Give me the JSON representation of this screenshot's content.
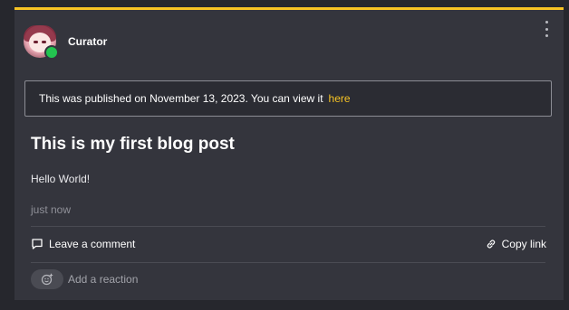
{
  "post": {
    "author": "Curator",
    "notice_text": "This was published on November 13, 2023. You can view it",
    "notice_link": "here",
    "title": "This is my first blog post",
    "body": "Hello World!",
    "time": "just now"
  },
  "actions": {
    "comment_label": "Leave a comment",
    "copy_label": "Copy link",
    "reaction_label": "Add a reaction"
  },
  "icons": {
    "menu": "more-vertical-icon",
    "comment": "comment-icon",
    "link": "link-icon",
    "reaction": "smiley-add-icon"
  },
  "colors": {
    "accent": "#f6c324",
    "status_online": "#23c450",
    "background": "#26272d",
    "card": "#34353d"
  }
}
